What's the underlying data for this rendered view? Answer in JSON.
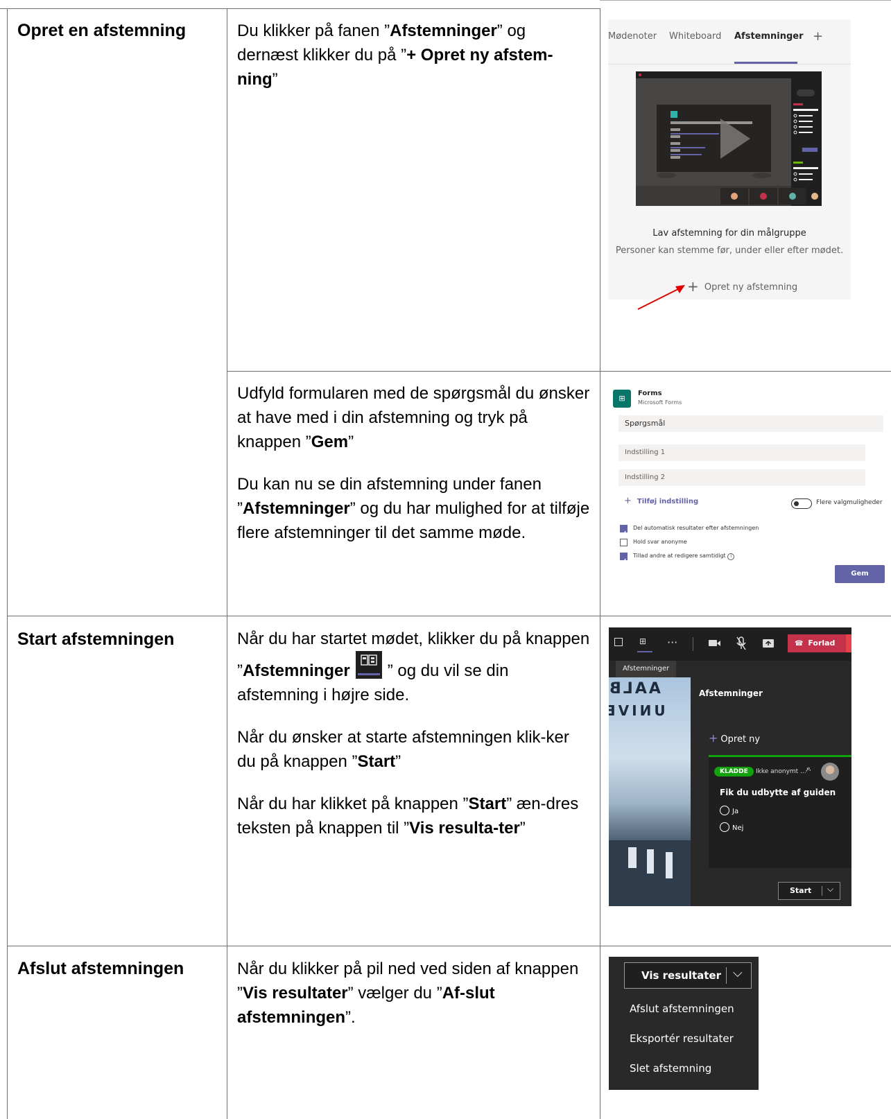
{
  "row1": {
    "heading": "Opret en afstemning",
    "step1": {
      "t1": "Du klikker på fanen ”",
      "b1": "Afstemninger",
      "t2": "” og dernæst klikker du på ”",
      "b2": "+ Opret ny afstem-ning",
      "t3": "”"
    },
    "step2": {
      "p1_t1": "Udfyld formularen med de spørgsmål du ønsker at have med i din afstemning og tryk på knappen ”",
      "p1_b1": "Gem",
      "p1_t2": "”",
      "p2_t1": "Du kan nu se din afstemning under fanen ”",
      "p2_b1": "Afstemninger",
      "p2_t2": "” og du har mulighed for at tilføje flere afstemninger til det samme møde."
    }
  },
  "row2": {
    "heading": "Start afstemningen",
    "p1_t1": "Når du har startet mødet, klikker du på knappen ”",
    "p1_b1": "Afstemninger",
    "p1_t2": "” og du vil se din afstemning i højre side.",
    "p2_t1": "Når du ønsker at starte afstemningen klik-ker du på knappen ”",
    "p2_b1": "Start",
    "p2_t2": "”",
    "p3_t1": "Når du har klikket på knappen ”",
    "p3_b1": "Start",
    "p3_t2": "” æn-dres teksten på knappen til ”",
    "p3_b2": "Vis resulta-ter",
    "p3_t3": "”"
  },
  "row3": {
    "heading": "Afslut afstemningen",
    "p1_t1": "Når du klikker på pil ned ved siden af knappen ”",
    "p1_b1": "Vis resultater",
    "p1_t2": "” vælger du ”",
    "p1_b2": "Af-slut afstemningen",
    "p1_t3": "”."
  },
  "shot1": {
    "tabs": [
      "Mødenoter",
      "Whiteboard",
      "Afstemninger",
      "+"
    ],
    "caption_title": "Lav afstemning for din målgruppe",
    "caption_sub": "Personer kan stemme før, under eller efter mødet.",
    "create_label": "Opret ny afstemning",
    "accent": "#6264a7"
  },
  "shot2": {
    "app_name": "Forms",
    "app_sub": "Microsoft Forms",
    "question_placeholder": "Spørgsmål",
    "option1": "Indstilling 1",
    "option2": "Indstilling 2",
    "add_option": "Tilføj indstilling",
    "multi_toggle": "Flere valgmuligheder",
    "check1": "Del automatisk resultater efter afstemningen",
    "check2": "Hold svar anonyme",
    "check3": "Tillad andre at redigere samtidigt",
    "save": "Gem"
  },
  "shot3": {
    "leave": "Forlad",
    "tooltip": "Afstemninger",
    "panel_title": "Afstemninger",
    "create_new": "Opret ny",
    "draft_badge": "KLADDE",
    "anon": "Ikke anonymt ...",
    "question": "Fik du udbytte af guiden",
    "answers": [
      "Ja",
      "Nej"
    ],
    "start": "Start",
    "photo_text1": "AALB",
    "photo_text2": "UNIVE"
  },
  "shot4": {
    "button": "Vis resultater",
    "menu": [
      "Afslut afstemningen",
      "Eksportér resultater",
      "Slet afstemning"
    ]
  }
}
